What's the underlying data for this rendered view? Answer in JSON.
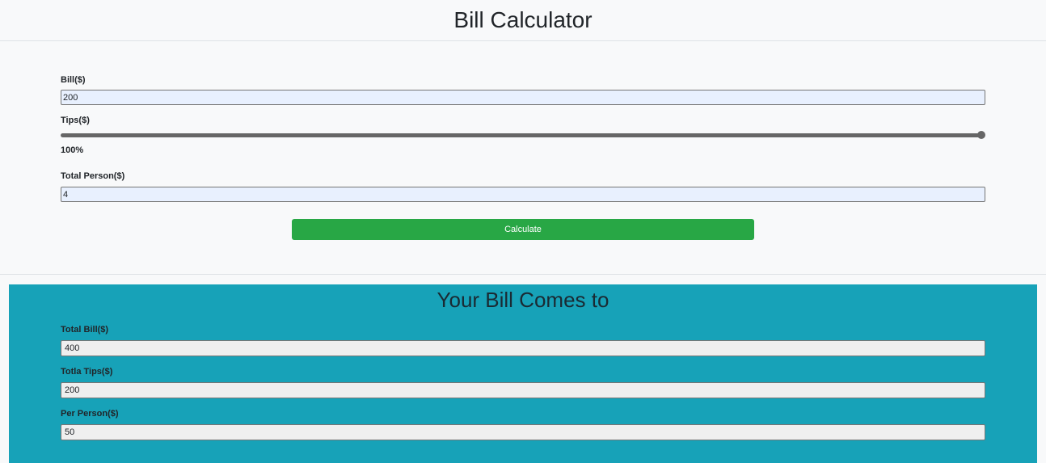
{
  "header": {
    "title": "Bill Calculator"
  },
  "form": {
    "bill_label": "Bill($)",
    "bill_value": "200",
    "tips_label": "Tips($)",
    "tips_percent_fraction": 1.0,
    "tips_percent_text": "100%",
    "persons_label": "Total Person($)",
    "persons_value": "4",
    "calculate_label": "Calculate",
    "calculate_color": "#28a745"
  },
  "result": {
    "title": "Your Bill Comes to",
    "background_color": "#17a2b8",
    "total_bill_label": "Total Bill($)",
    "total_bill_value": "400",
    "total_tips_label": "Totla Tips($)",
    "total_tips_value": "200",
    "per_person_label": "Per Person($)",
    "per_person_value": "50"
  }
}
